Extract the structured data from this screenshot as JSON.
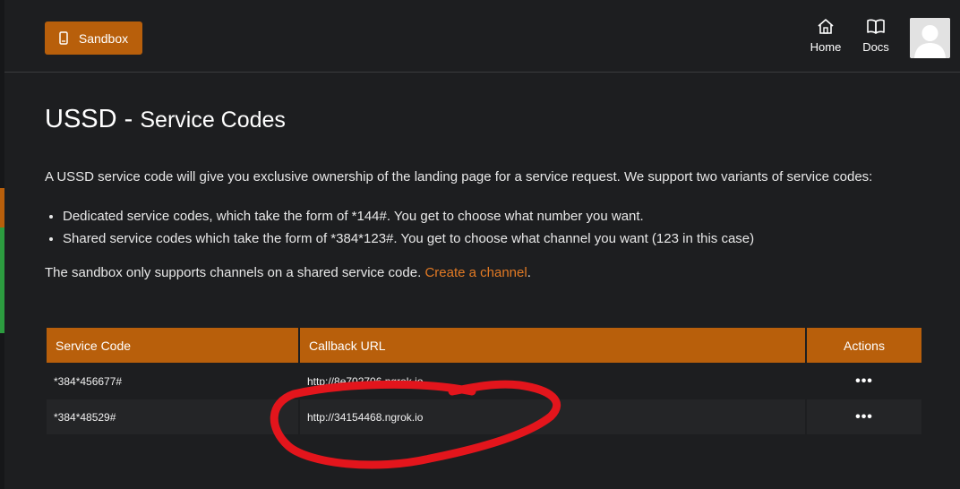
{
  "header": {
    "sandbox_label": "Sandbox",
    "nav": [
      {
        "label": "Home",
        "icon": "home-icon"
      },
      {
        "label": "Docs",
        "icon": "book-icon"
      }
    ],
    "avatar_icon": "user-avatar-icon"
  },
  "page": {
    "title_main": "USSD",
    "title_separator": " - ",
    "title_sub": "Service Codes",
    "intro": "A USSD service code will give you exclusive ownership of the landing page for a service request. We support two variants of service codes:",
    "variants": [
      "Dedicated service codes, which take the form of *144#. You get to choose what number you want.",
      "Shared service codes which take the form of *384*123#. You get to choose what channel you want (123 in this case)"
    ],
    "sandbox_note_prefix": "The sandbox only supports channels on a shared service code. ",
    "sandbox_note_link": "Create a channel",
    "sandbox_note_suffix": "."
  },
  "table": {
    "headers": [
      "Service Code",
      "Callback URL",
      "Actions"
    ],
    "rows": [
      {
        "service_code": "*384*456677#",
        "callback_url": "http://8e702706.ngrok.io",
        "actions": "•••"
      },
      {
        "service_code": "*384*48529#",
        "callback_url": "http://34154468.ngrok.io",
        "actions": "•••"
      }
    ]
  },
  "colors": {
    "accent": "#b85f0b",
    "link": "#e27a24",
    "background": "#1d1e20",
    "annotation": "#e3151c"
  }
}
